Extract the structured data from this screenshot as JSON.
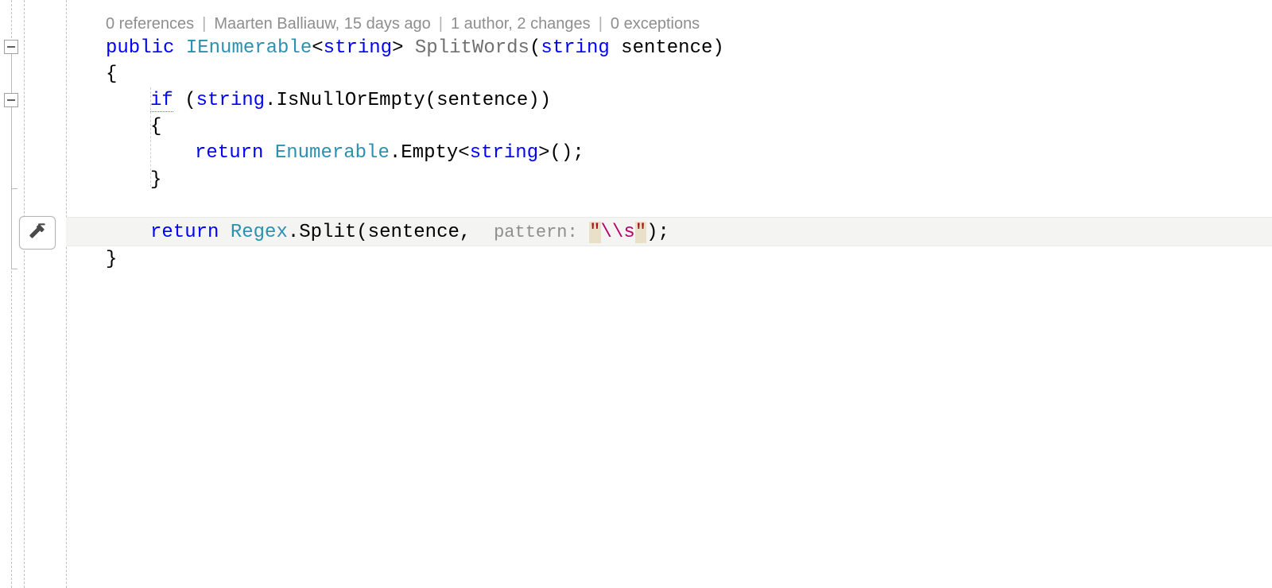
{
  "codelens": {
    "references": "0 references",
    "blame": "Maarten Balliauw, 15 days ago",
    "authors": "1 author, 2 changes",
    "exceptions": "0 exceptions"
  },
  "code": {
    "l1": {
      "public": "public",
      "ienum": "IEnumerable",
      "lt": "<",
      "string1": "string",
      "gt": ">",
      "method": "SplitWords",
      "open": "(",
      "string2": "string",
      "param": " sentence",
      "close": ")"
    },
    "l2": {
      "brace": "{"
    },
    "l3": {
      "if": "if",
      "open": " (",
      "string": "string",
      "call": ".IsNullOrEmpty(sentence))"
    },
    "l4": {
      "brace": "{"
    },
    "l5": {
      "return": "return",
      "space": " ",
      "enum": "Enumerable",
      "dot": ".Empty<",
      "string": "string",
      "tail": ">();"
    },
    "l6": {
      "brace": "}"
    },
    "l7": {
      "return": "return",
      "space": " ",
      "regex": "Regex",
      "call1": ".Split(sentence,  ",
      "hint": "pattern:",
      "q1": "\"",
      "esc": "\\\\s",
      "q2": "\"",
      "tail": ");"
    },
    "l8": {
      "brace": "}"
    }
  },
  "icons": {
    "hammer": "hammer-icon"
  },
  "colors": {
    "keyword": "#0000ff",
    "type": "#2b91af",
    "string": "#a31515",
    "escape": "#b5006a"
  }
}
